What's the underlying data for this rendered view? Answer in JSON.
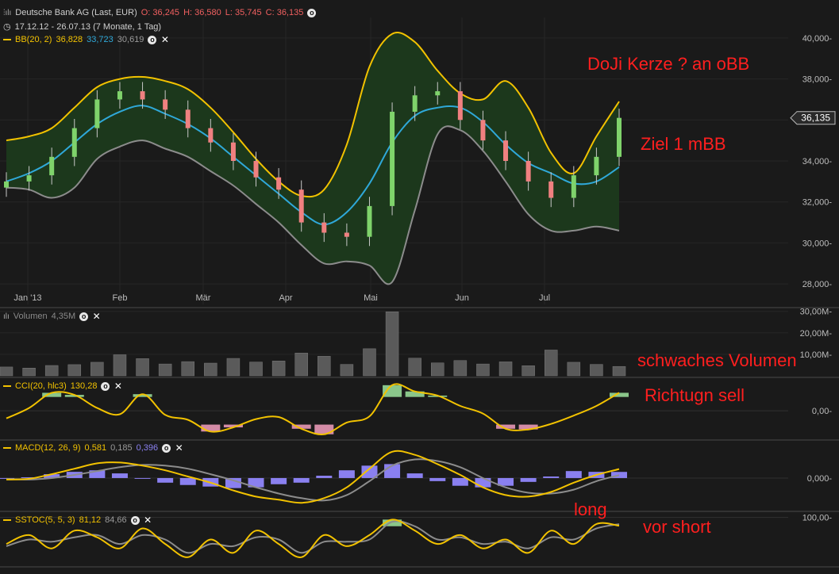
{
  "instrument": {
    "name": "Deutsche Bank AG (Last, EUR)",
    "o": "O: 36,245",
    "h": "H: 36,580",
    "l": "L: 35,745",
    "c": "C: 36,135",
    "range": "17.12.12 - 26.07.13 (7 Monate, 1 Tag)",
    "last_price": "36,135"
  },
  "indicators": {
    "bb": {
      "label": "BB(20, 2)",
      "v1": "36,828",
      "v2": "33,723",
      "v3": "30,619"
    },
    "vol": {
      "label": "Volumen",
      "v1": "4,35M"
    },
    "cci": {
      "label": "CCI(20, hlc3)",
      "v1": "130,28"
    },
    "macd": {
      "label": "MACD(12, 26, 9)",
      "v1": "0,581",
      "v2": "0,185",
      "v3": "0,396"
    },
    "sstoc": {
      "label": "SSTOC(5, 5, 3)",
      "v1": "81,12",
      "v2": "84,66"
    }
  },
  "annotations": {
    "doji": "DoJi Kerze ? an oBB",
    "ziel": "Ziel 1 mBB",
    "volumen": "schwaches Volumen",
    "richtung": "Richtugn sell",
    "long": "long",
    "short": "vor short"
  },
  "colors": {
    "background": "#1a1a1a",
    "band_fill": "#1c3a1c",
    "upper_band": "#f2c200",
    "middle_band": "#2fa8d8",
    "lower_band": "#8c8c8c",
    "candle_up": "#7fd36b",
    "candle_down": "#f08080",
    "annotation": "#ff1f1f",
    "macd_hist": "#8a80f0"
  },
  "chart_data": [
    {
      "type": "candlestick",
      "title": "Deutsche Bank AG (Last, EUR)",
      "x_ticks": [
        "Jan '13",
        "Feb",
        "Mär",
        "Apr",
        "Mai",
        "Jun",
        "Jul"
      ],
      "y_ticks": [
        "40,000",
        "38,000",
        "36,000",
        "34,000",
        "32,000",
        "30,000",
        "28,000"
      ],
      "ylim": [
        27.0,
        41.0
      ],
      "series": [
        {
          "name": "BB(20, 2) upper",
          "values": [
            35.0,
            35.2,
            35.6,
            36.6,
            37.6,
            38.0,
            38.1,
            37.9,
            37.5,
            36.6,
            35.4,
            34.1,
            33.0,
            32.3,
            32.6,
            34.8,
            38.6,
            40.2,
            39.8,
            38.4,
            37.3,
            37.0,
            37.9,
            36.6,
            34.4,
            33.4,
            35.2,
            36.9
          ]
        },
        {
          "name": "BB(20, 2) middle",
          "values": [
            33.0,
            33.4,
            34.0,
            34.9,
            35.8,
            36.4,
            36.7,
            36.3,
            35.8,
            35.1,
            34.2,
            33.3,
            32.4,
            31.5,
            30.9,
            31.5,
            32.9,
            34.9,
            36.2,
            36.6,
            36.6,
            35.9,
            34.8,
            33.9,
            33.4,
            32.9,
            33.0,
            33.7
          ]
        },
        {
          "name": "BB(20, 2) lower",
          "values": [
            32.7,
            32.6,
            32.2,
            32.7,
            34.1,
            34.7,
            35.0,
            34.6,
            34.2,
            33.5,
            32.8,
            31.9,
            31.0,
            29.9,
            29.0,
            29.1,
            28.9,
            28.1,
            31.6,
            35.3,
            35.5,
            34.5,
            33.0,
            31.4,
            30.6,
            30.6,
            30.8,
            30.6
          ]
        },
        {
          "name": "Last",
          "values": [
            33.0,
            33.3,
            34.2,
            35.6,
            37.0,
            37.4,
            37.0,
            36.5,
            35.6,
            34.9,
            34.0,
            33.2,
            32.6,
            31.0,
            30.5,
            30.3,
            31.8,
            36.4,
            37.2,
            37.4,
            36.0,
            35.0,
            34.0,
            33.0,
            32.2,
            33.3,
            34.2,
            36.1
          ]
        }
      ]
    },
    {
      "type": "bar",
      "title": "Volumen",
      "y_ticks": [
        "30,00M",
        "20,00M",
        "10,00M"
      ],
      "ylim": [
        0,
        31
      ],
      "series": [
        {
          "name": "Volumen",
          "values": [
            4.1,
            3.6,
            4.8,
            5.2,
            6.3,
            9.8,
            8.0,
            5.5,
            6.6,
            5.9,
            8.1,
            6.4,
            6.9,
            10.6,
            9.1,
            5.3,
            12.6,
            29.8,
            8.2,
            6.0,
            7.1,
            5.5,
            6.5,
            4.7,
            12.0,
            6.3,
            5.3,
            4.35
          ]
        }
      ]
    },
    {
      "type": "area",
      "title": "CCI(20, hlc3)",
      "y_ticks": [
        "0,00"
      ],
      "ylim": [
        -200,
        230
      ],
      "series": [
        {
          "name": "CCI",
          "values": [
            -55,
            20,
            130,
            115,
            20,
            -25,
            120,
            -30,
            -65,
            -150,
            -120,
            -60,
            -45,
            -130,
            -170,
            -85,
            -40,
            185,
            140,
            110,
            35,
            -20,
            -130,
            -135,
            -95,
            -35,
            35,
            130
          ]
        }
      ]
    },
    {
      "type": "line",
      "title": "MACD(12, 26, 9)",
      "y_ticks": [
        "0,000"
      ],
      "ylim": [
        -2.0,
        2.2
      ],
      "series": [
        {
          "name": "MACD",
          "values": [
            -0.1,
            -0.05,
            0.25,
            0.6,
            0.95,
            1.0,
            0.8,
            0.5,
            0.1,
            -0.3,
            -0.8,
            -1.2,
            -1.4,
            -1.6,
            -1.3,
            -0.6,
            0.6,
            1.7,
            1.5,
            0.9,
            0.2,
            -0.6,
            -1.1,
            -1.2,
            -0.9,
            -0.3,
            0.2,
            0.58
          ]
        },
        {
          "name": "Signal",
          "values": [
            -0.05,
            -0.1,
            0.0,
            0.2,
            0.45,
            0.7,
            0.85,
            0.8,
            0.6,
            0.25,
            -0.15,
            -0.6,
            -1.0,
            -1.3,
            -1.45,
            -1.1,
            -0.2,
            0.8,
            1.2,
            1.1,
            0.7,
            0.0,
            -0.6,
            -0.95,
            -1.0,
            -0.75,
            -0.2,
            0.185
          ]
        },
        {
          "name": "Histogramm",
          "values": [
            -0.05,
            0.05,
            0.25,
            0.4,
            0.5,
            0.3,
            -0.05,
            -0.3,
            -0.45,
            -0.55,
            -0.65,
            -0.6,
            -0.4,
            -0.3,
            0.15,
            0.5,
            0.8,
            0.9,
            0.3,
            -0.2,
            -0.5,
            -0.6,
            -0.5,
            -0.25,
            0.1,
            0.45,
            0.4,
            0.396
          ]
        }
      ]
    },
    {
      "type": "line",
      "title": "SSTOC(5, 5, 3)",
      "y_ticks": [
        "100,00"
      ],
      "ylim": [
        -10,
        110
      ],
      "series": [
        {
          "name": "%K",
          "values": [
            40,
            60,
            30,
            70,
            55,
            30,
            75,
            40,
            10,
            50,
            20,
            70,
            40,
            10,
            60,
            35,
            60,
            95,
            70,
            40,
            60,
            30,
            50,
            20,
            70,
            40,
            85,
            81.12
          ]
        },
        {
          "name": "%D",
          "values": [
            35,
            50,
            45,
            55,
            60,
            40,
            60,
            50,
            20,
            40,
            35,
            55,
            50,
            20,
            45,
            45,
            50,
            90,
            80,
            50,
            55,
            40,
            45,
            30,
            55,
            50,
            75,
            84.66
          ]
        }
      ]
    }
  ]
}
